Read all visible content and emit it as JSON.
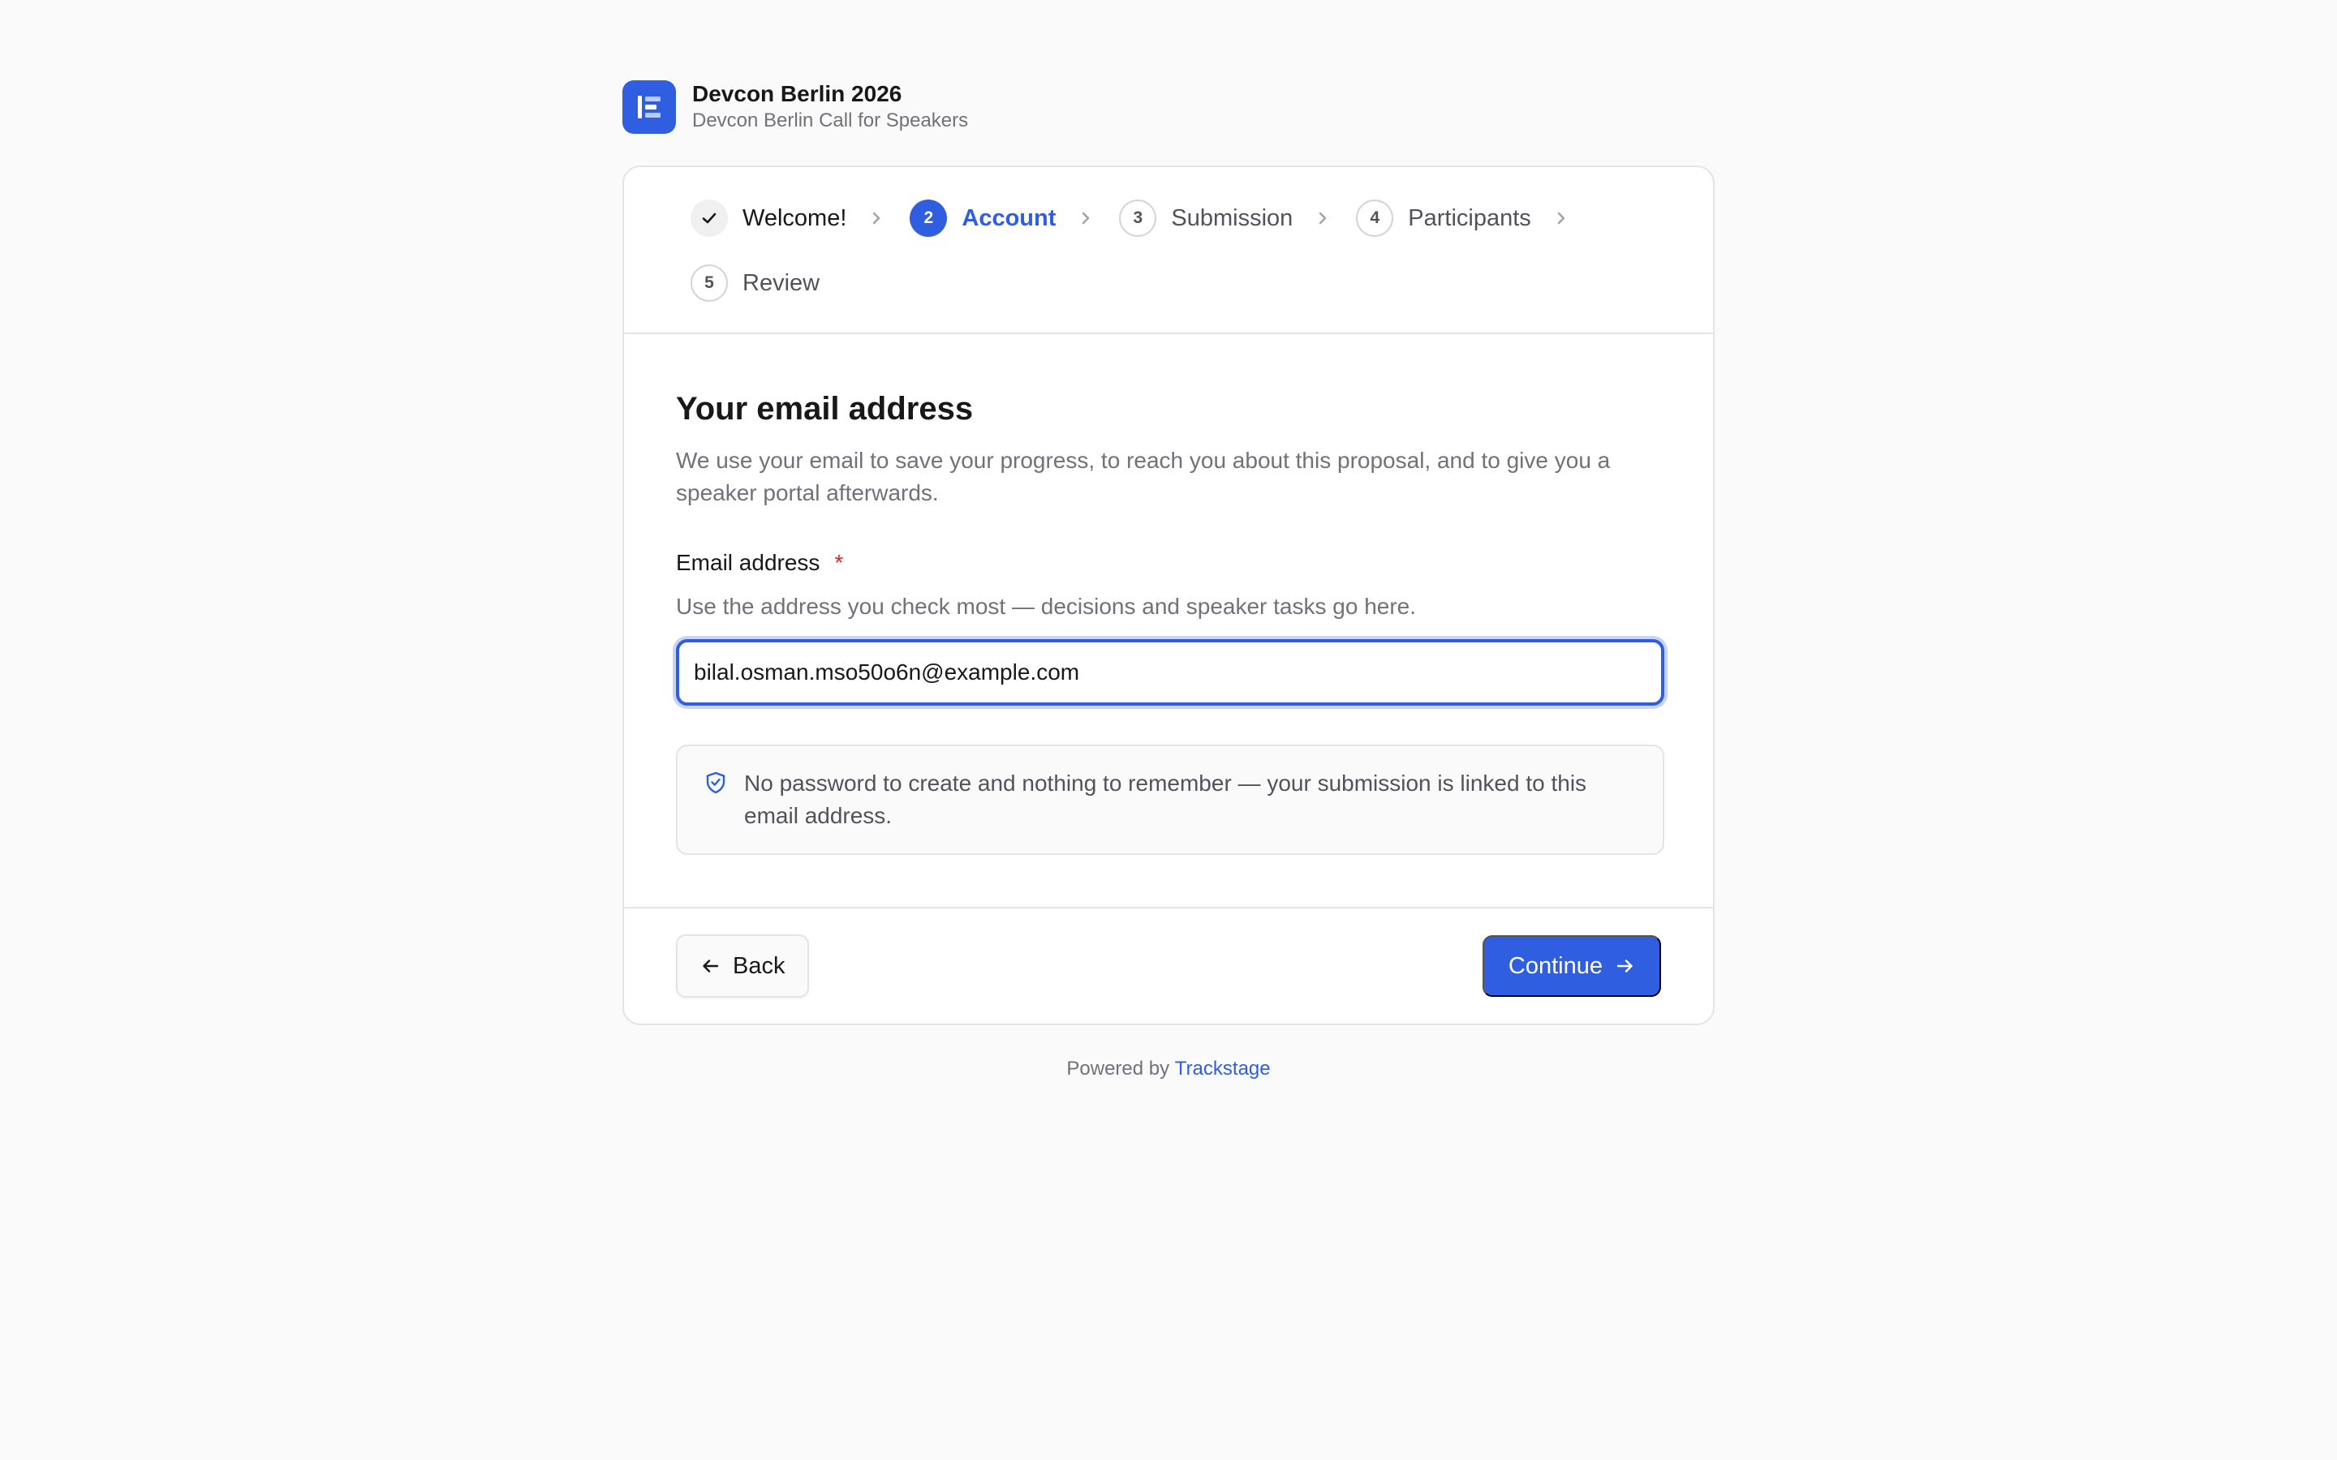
{
  "org": {
    "title": "Devcon Berlin 2026",
    "subtitle": "Devcon Berlin Call for Speakers",
    "logo_icon": "event-logo-icon",
    "brand_color": "#2f5ee0"
  },
  "steps": [
    {
      "number": "1",
      "label": "Welcome!",
      "state": "done",
      "icon": "check-icon"
    },
    {
      "number": "2",
      "label": "Account",
      "state": "active"
    },
    {
      "number": "3",
      "label": "Submission",
      "state": "todo"
    },
    {
      "number": "4",
      "label": "Participants",
      "state": "todo"
    },
    {
      "number": "5",
      "label": "Review",
      "state": "todo"
    }
  ],
  "form": {
    "heading": "Your email address",
    "description": "We use your email to save your progress, to reach you about this proposal, and to give you a speaker portal afterwards.",
    "email_label": "Email address",
    "required_mark": "*",
    "email_hint": "Use the address you check most — decisions and speaker tasks go here.",
    "email_value": "bilal.osman.mso50o6n@example.com",
    "notice_icon": "shield-check-icon",
    "notice_text": "No password to create and nothing to remember — your submission is linked to this email address."
  },
  "actions": {
    "back_label": "Back",
    "back_icon": "arrow-left-icon",
    "continue_label": "Continue",
    "continue_icon": "arrow-right-icon"
  },
  "footer": {
    "powered_prefix": "Powered by",
    "powered_link": "Trackstage"
  }
}
